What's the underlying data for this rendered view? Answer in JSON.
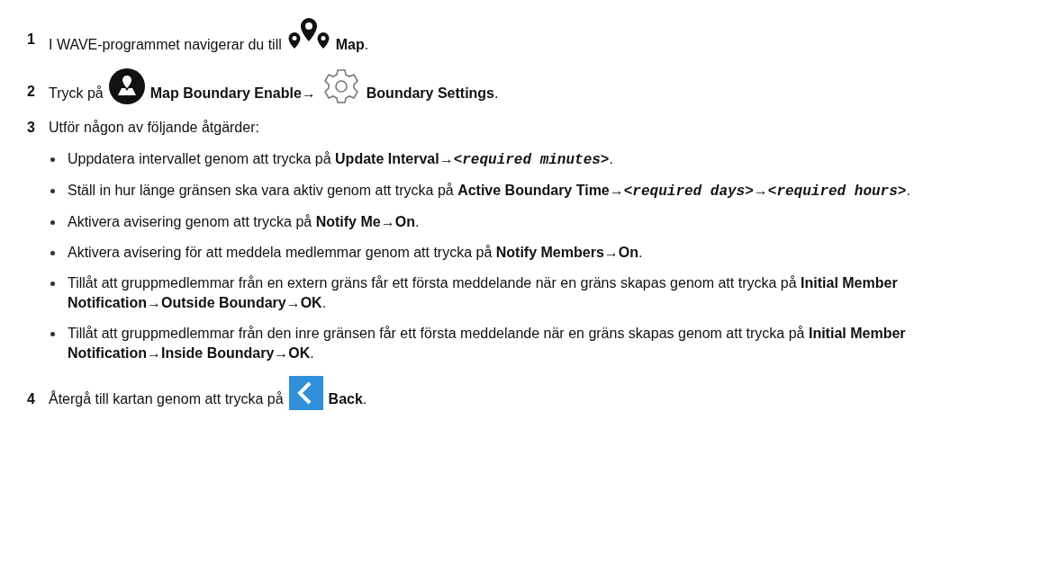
{
  "steps": [
    {
      "number": "1",
      "parts": [
        {
          "kind": "text",
          "text": "I WAVE-programmet navigerar du till"
        },
        {
          "kind": "icon"
        },
        {
          "kind": "text",
          "text": "**Map**."
        }
      ]
    },
    {
      "number": "2",
      "parts": [
        {
          "kind": "text",
          "text": "Tryck på"
        },
        {
          "kind": "icon"
        },
        {
          "kind": "text",
          "text": "**Map Boundary Enable**→"
        },
        {
          "kind": "icon"
        },
        {
          "kind": "text",
          "text": "**Boundary Settings**."
        }
      ]
    },
    {
      "number": "3",
      "parts": [
        {
          "kind": "text",
          "text": "Utför någon av följande åtgärder:"
        }
      ],
      "bullets": [
        [
          {
            "kind": "text",
            "text": "Uppdatera intervallet genom att trycka på **Update Interval→**"
          },
          {
            "kind": "code",
            "text": "<required minutes>"
          },
          {
            "kind": "text",
            "text": "."
          }
        ],
        [
          {
            "kind": "text",
            "text": "Ställ in hur länge gränsen ska vara aktiv genom att trycka på **Active Boundary Time→**"
          },
          {
            "kind": "code",
            "text": "<required days>"
          },
          {
            "kind": "text",
            "text": "**→**"
          },
          {
            "kind": "code",
            "text": "<required hours>"
          },
          {
            "kind": "text",
            "text": "."
          }
        ],
        [
          {
            "kind": "text",
            "text": "Aktivera avisering genom att trycka på **Notify Me**→**On**."
          }
        ],
        [
          {
            "kind": "text",
            "text": "Aktivera avisering för att meddela medlemmar genom att trycka på **Notify Members→On**."
          }
        ],
        [
          {
            "kind": "text",
            "text": "Tillåt att gruppmedlemmar från en extern gräns får ett första meddelande när en gräns skapas genom att trycka på **Initial Member Notification→Outside Boundary→OK**."
          }
        ],
        [
          {
            "kind": "text",
            "text": "Tillåt att gruppmedlemmar från den inre gränsen får ett första meddelande när en gräns skapas genom att trycka på **Initial Member Notification→Inside Boundary→OK**."
          }
        ]
      ]
    },
    {
      "number": "4",
      "parts": [
        {
          "kind": "text",
          "text": "Återgå till kartan genom att trycka på"
        },
        {
          "kind": "icon"
        },
        {
          "kind": "text",
          "text": "**Back**."
        }
      ]
    }
  ]
}
